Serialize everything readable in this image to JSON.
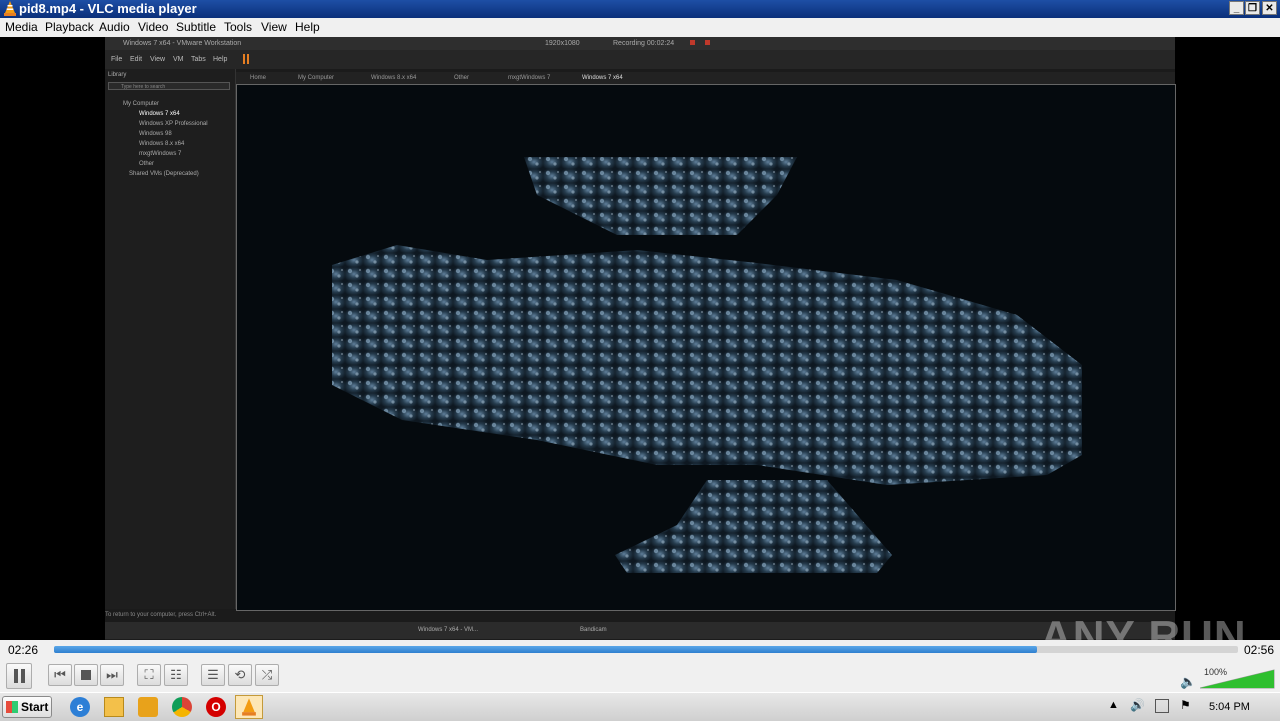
{
  "window": {
    "title": "pid8.mp4 - VLC media player",
    "minimize_symbol": "_",
    "restore_symbol": "❐",
    "close_symbol": "✕"
  },
  "menu": [
    "Media",
    "Playback",
    "Audio",
    "Video",
    "Subtitle",
    "Tools",
    "View",
    "Help"
  ],
  "player": {
    "elapsed": "02:26",
    "total": "02:56",
    "progress": 0.83,
    "volume_label": "100%",
    "volume": 1.0
  },
  "watermark": "ANY RUN",
  "video_frame": {
    "vm_title": "Windows 7 x64 - VMware Workstation",
    "vm_menu": [
      "File",
      "Edit",
      "View",
      "VM",
      "Tabs",
      "Help"
    ],
    "resolution": "1920x1080",
    "rec_text": "Recording 00:02:24",
    "library_title": "Library",
    "library_search": "Type here to search",
    "library_tree": [
      "My Computer",
      "Windows 7 x64",
      "Windows XP Professional",
      "Windows 98",
      "Windows 8.x x64",
      "mxgtWindows 7",
      "Other",
      "Shared VMs (Deprecated)"
    ],
    "tabs": [
      "Home",
      "My Computer",
      "Windows 8.x x64",
      "Other",
      "mxgtWindows 7",
      "Windows 7 x64"
    ],
    "status_text": "To return to your computer, press Ctrl+Alt.",
    "taskbar_items": [
      "Windows 7 x64 - VM...",
      "Bandicam"
    ]
  },
  "taskbar": {
    "start_label": "Start",
    "clock": "5:04 PM"
  },
  "icons": {
    "pause": "pause-icon",
    "prev": "previous-icon",
    "stop": "stop-icon",
    "next": "next-icon",
    "fullscreen": "fullscreen-icon",
    "extended": "extended-settings-icon",
    "playlist": "playlist-icon",
    "loop": "loop-icon",
    "shuffle": "shuffle-icon",
    "volume": "speaker-icon"
  },
  "colors": {
    "title_bar": "#0a2f7a",
    "seek_fill": "#2f7fcf",
    "volume_fill": "#2fbf2f"
  }
}
